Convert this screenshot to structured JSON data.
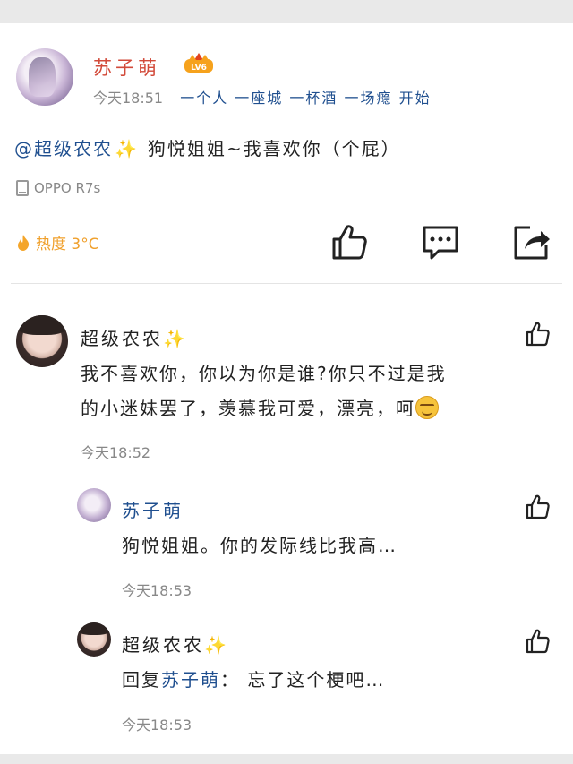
{
  "post": {
    "author": "苏子萌",
    "level_badge": "LV6",
    "time": "今天18:51",
    "signature": "一个人 一座城 一杯酒 一场瘾 开始",
    "mention": "@超级农农",
    "sparkle": "✨",
    "text": "狗悦姐姐~我喜欢你（个屁）",
    "device": "OPPO R7s",
    "heat": "热度 3°C"
  },
  "comments": [
    {
      "name": "超级农农",
      "sparkle": "✨",
      "text_line1": "我不喜欢你，你以为你是谁?你只不过是我",
      "text_line2": "的小迷妹罢了，羡慕我可爱，漂亮，呵",
      "time": "今天18:52"
    }
  ],
  "replies": [
    {
      "name": "苏子萌",
      "text": "狗悦姐姐。你的发际线比我高…",
      "time": "今天18:53"
    },
    {
      "name": "超级农农",
      "sparkle": "✨",
      "reply_prefix": "回复",
      "reply_to": "苏子萌",
      "reply_suffix": "：  忘了这个梗吧…",
      "time": "今天18:53"
    }
  ],
  "colors": {
    "author_red": "#d24a3a",
    "link_blue": "#1f4f8f",
    "heat_orange": "#f0a02c",
    "meta_gray": "#888888"
  },
  "icons": [
    "level-badge-icon",
    "sparkle-icon",
    "phone-icon",
    "flame-icon",
    "like-icon",
    "comment-icon",
    "share-icon",
    "smile-emoji-icon"
  ]
}
